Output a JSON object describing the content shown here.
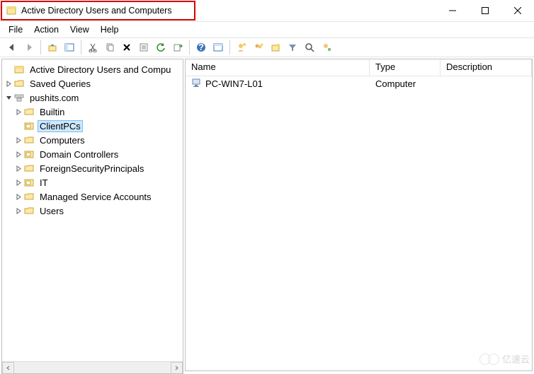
{
  "window": {
    "title": "Active Directory Users and Computers"
  },
  "menu": {
    "file": "File",
    "action": "Action",
    "view": "View",
    "help": "Help"
  },
  "tree": {
    "root": "Active Directory Users and Compu",
    "saved": "Saved Queries",
    "domain": "pushits.com",
    "children": {
      "builtin": "Builtin",
      "clientpcs": "ClientPCs",
      "computers": "Computers",
      "dc": "Domain Controllers",
      "fsp": "ForeignSecurityPrincipals",
      "it": "IT",
      "msa": "Managed Service Accounts",
      "users": "Users"
    }
  },
  "list": {
    "columns": {
      "name": "Name",
      "type": "Type",
      "desc": "Description"
    },
    "rows": [
      {
        "name": "PC-WIN7-L01",
        "type": "Computer",
        "desc": ""
      }
    ]
  },
  "watermark": "亿速云"
}
